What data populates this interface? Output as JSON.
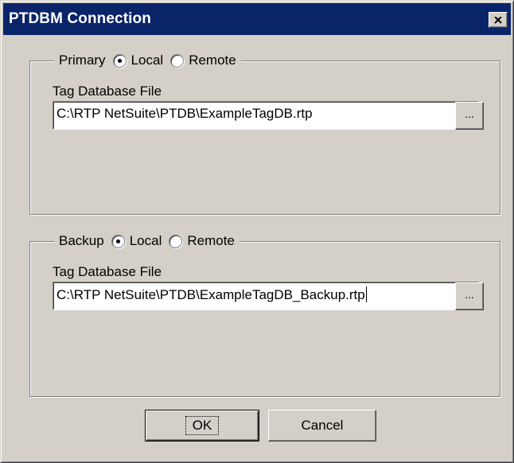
{
  "window": {
    "title": "PTDBM Connection",
    "close_icon": "close-x-icon"
  },
  "primary": {
    "legend": "Primary",
    "local_label": "Local",
    "remote_label": "Remote",
    "selected": "Local",
    "field_label": "Tag Database File",
    "file_value": "C:\\RTP NetSuite\\PTDB\\ExampleTagDB.rtp",
    "browse_label": "..."
  },
  "backup": {
    "legend": "Backup",
    "local_label": "Local",
    "remote_label": "Remote",
    "selected": "Local",
    "field_label": "Tag Database File",
    "file_value": "C:\\RTP NetSuite\\PTDB\\ExampleTagDB_Backup.rtp",
    "browse_label": "..."
  },
  "buttons": {
    "ok_label": "OK",
    "cancel_label": "Cancel"
  },
  "colors": {
    "titlebar": "#0a246a",
    "face": "#d4d0c8",
    "shadow": "#808080",
    "highlight": "#ffffff"
  }
}
